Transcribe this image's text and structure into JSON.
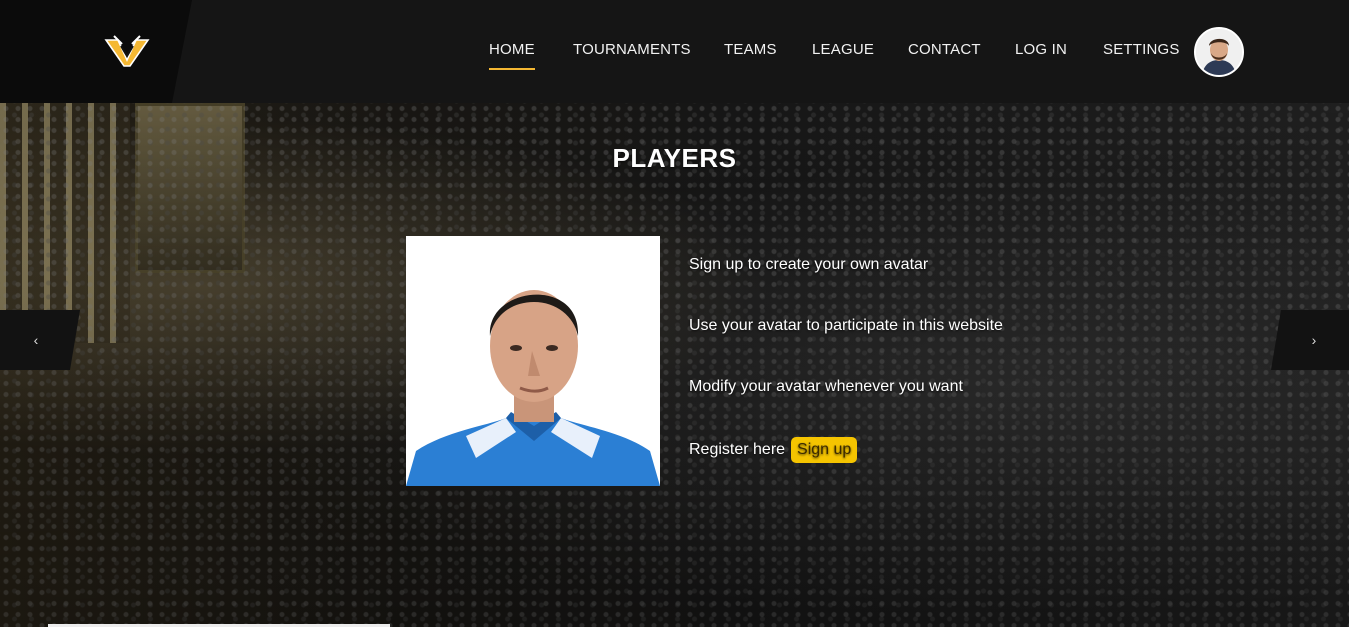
{
  "nav": {
    "items": [
      {
        "label": "HOME",
        "active": true
      },
      {
        "label": "TOURNAMENTS",
        "active": false
      },
      {
        "label": "TEAMS",
        "active": false
      },
      {
        "label": "LEAGUE",
        "active": false
      },
      {
        "label": "CONTACT",
        "active": false
      },
      {
        "label": "LOG IN",
        "active": false
      },
      {
        "label": "SETTINGS",
        "active": false
      }
    ]
  },
  "hero": {
    "title": "PLAYERS",
    "lines": [
      "Sign up to create your own avatar",
      "Use your avatar to participate in this website",
      "Modify your avatar whenever you want"
    ],
    "register_text": "Register here",
    "signup_label": "Sign up",
    "prev_arrow": "‹",
    "next_arrow": "›"
  },
  "colors": {
    "accent": "#f5b833",
    "signup_bg": "#f5c400",
    "header_bg": "#151515"
  },
  "icons": {
    "logo": "v-wing-logo",
    "prev": "chevron-left-icon",
    "next": "chevron-right-icon"
  }
}
